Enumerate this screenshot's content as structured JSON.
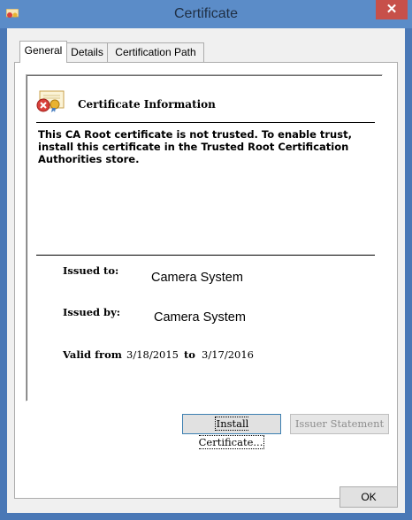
{
  "window": {
    "title": "Certificate",
    "close_glyph": "✕",
    "app_icon": "certificate-icon"
  },
  "tabs": [
    {
      "label": "General",
      "active": true
    },
    {
      "label": "Details",
      "active": false
    },
    {
      "label": "Certification Path",
      "active": false
    }
  ],
  "info": {
    "heading": "Certificate Information",
    "icon": "untrusted-certificate-icon",
    "warning": "This CA Root certificate is not trusted. To enable trust, install this certificate in the Trusted Root Certification Authorities store.",
    "issued_to_label": "Issued to:",
    "issued_to_value": "Camera System",
    "issued_by_label": "Issued by:",
    "issued_by_value": "Camera System",
    "valid_from_label": "Valid from",
    "valid_from": "3/18/2015",
    "to_label": "to",
    "valid_to": "3/17/2016"
  },
  "buttons": {
    "install": "Install Certificate...",
    "issuer_statement": "Issuer Statement",
    "ok": "OK"
  },
  "colors": {
    "titlebar": "#5b8cc8",
    "close": "#c7504a",
    "frame": "#4a78b6"
  }
}
